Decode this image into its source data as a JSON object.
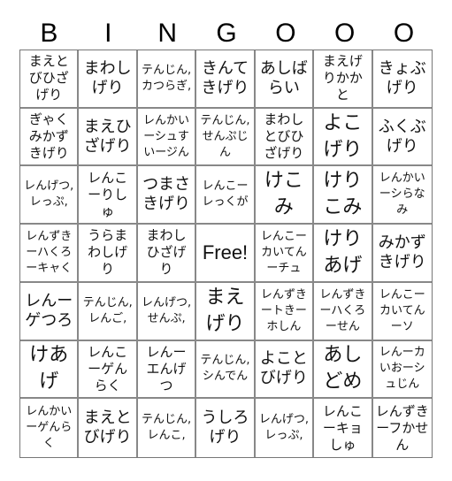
{
  "header": {
    "letters": [
      "B",
      "I",
      "N",
      "G",
      "O",
      "O",
      "O"
    ]
  },
  "cells": [
    {
      "text": "まえとびひざげり",
      "size": "s3"
    },
    {
      "text": "まわしげり",
      "size": "s2"
    },
    {
      "text": "テんじん, カつらぎ,",
      "size": "s4"
    },
    {
      "text": "きんてきげり",
      "size": "s2"
    },
    {
      "text": "あしばらい",
      "size": "s2"
    },
    {
      "text": "まえげりかかと",
      "size": "s3"
    },
    {
      "text": "きょぶげり",
      "size": "s2"
    },
    {
      "text": "ぎゃくみかずきげり",
      "size": "s3"
    },
    {
      "text": "まえひざげり",
      "size": "s2"
    },
    {
      "text": "レんかいーシュすいージん",
      "size": "s4"
    },
    {
      "text": "テんじん, せんぷじん",
      "size": "s4"
    },
    {
      "text": "まわしとびひざげり",
      "size": "s3"
    },
    {
      "text": "よこげり",
      "size": "s1"
    },
    {
      "text": "ふくぶげり",
      "size": "s2"
    },
    {
      "text": "レんげつ, レっぷ,",
      "size": "s4"
    },
    {
      "text": "レんこーりしゅ",
      "size": "s3"
    },
    {
      "text": "つまさきげり",
      "size": "s2"
    },
    {
      "text": "レんこーレっくが",
      "size": "s4"
    },
    {
      "text": "けこみ",
      "size": "s1"
    },
    {
      "text": "けりこみ",
      "size": "s1"
    },
    {
      "text": "レんかいーシらなみ",
      "size": "s4"
    },
    {
      "text": "レんずきーハくろーキャく",
      "size": "s4"
    },
    {
      "text": "うらまわしげり",
      "size": "s3"
    },
    {
      "text": "まわしひざげり",
      "size": "s3"
    },
    {
      "text": "Free!",
      "size": "free"
    },
    {
      "text": "レんこーカいてんーチュ",
      "size": "s4"
    },
    {
      "text": "けりあげ",
      "size": "s1"
    },
    {
      "text": "みかずきげり",
      "size": "s2"
    },
    {
      "text": "レんーゲつろ",
      "size": "s2"
    },
    {
      "text": "テんじん, レんご,",
      "size": "s4"
    },
    {
      "text": "レんげつ, せんぷ,",
      "size": "s4"
    },
    {
      "text": "まえげり",
      "size": "s1"
    },
    {
      "text": "レんずきートきーホしん",
      "size": "s4"
    },
    {
      "text": "レんずきーハくろーせん",
      "size": "s4"
    },
    {
      "text": "レんこーカいてんーソ",
      "size": "s4"
    },
    {
      "text": "けあげ",
      "size": "s1"
    },
    {
      "text": "レんこーゲんらく",
      "size": "s3"
    },
    {
      "text": "レんーエんげつ",
      "size": "s3"
    },
    {
      "text": "テんじん, シんでん",
      "size": "s4"
    },
    {
      "text": "よことびげり",
      "size": "s2"
    },
    {
      "text": "あしどめ",
      "size": "s1"
    },
    {
      "text": "レんーカいおーシュじん",
      "size": "s4"
    },
    {
      "text": "レんかいーゲんらく",
      "size": "s4"
    },
    {
      "text": "まえとびげり",
      "size": "s2"
    },
    {
      "text": "テんじん, レんこ,",
      "size": "s4"
    },
    {
      "text": "うしろげり",
      "size": "s2"
    },
    {
      "text": "レんげつ, レっぷ,",
      "size": "s4"
    },
    {
      "text": "レんこーキョしゅ",
      "size": "s3"
    },
    {
      "text": "レんずきーフかせん",
      "size": "s3"
    }
  ]
}
